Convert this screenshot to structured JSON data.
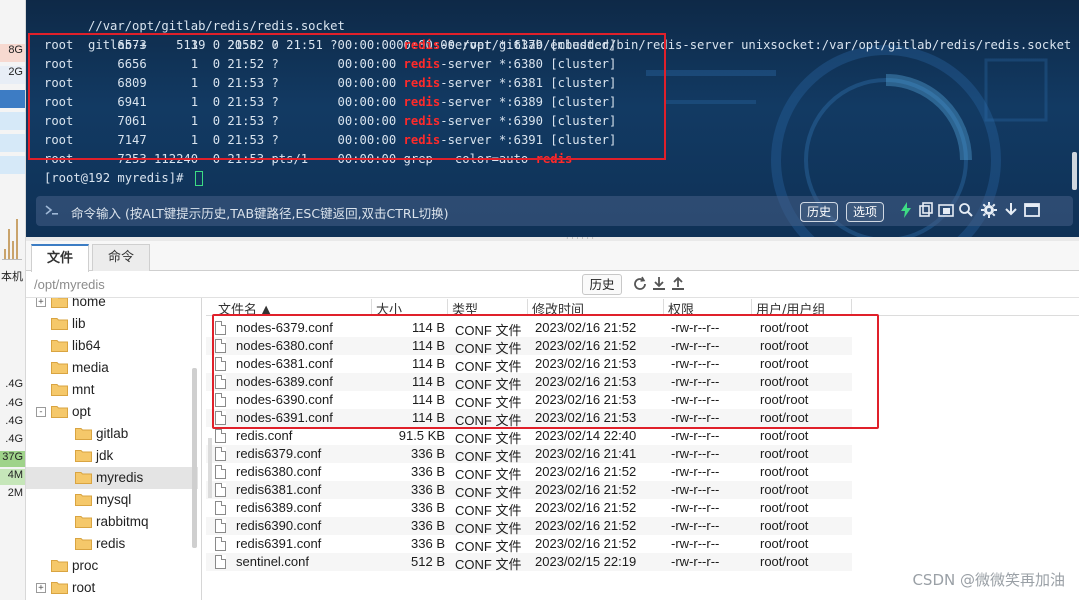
{
  "left_panel": {
    "values_top": [
      "8G",
      "2G"
    ],
    "label_mid": "本机",
    "values_bottom": [
      ".4G",
      ".4G",
      ".4G",
      ".4G",
      "37G",
      "4M",
      "2M"
    ]
  },
  "terminal": {
    "line0": "//var/opt/gitlab/redis/redis.socket",
    "line1": "gitlab-+    5139   2058  0 21:51 ?        00:00:00 /opt/gitlab/embedded/bin/redis-server unixsocket:/var/opt/gitlab/redis/redis.socket",
    "processes": [
      {
        "user": "root",
        "pid": "6573",
        "ppid": "1",
        "c": "0",
        "stime": "21:52",
        "tty": "?",
        "time": "00:00:00",
        "cmd": "redis",
        "rest": "-server *:6379 [cluster]"
      },
      {
        "user": "root",
        "pid": "6656",
        "ppid": "1",
        "c": "0",
        "stime": "21:52",
        "tty": "?",
        "time": "00:00:00",
        "cmd": "redis",
        "rest": "-server *:6380 [cluster]"
      },
      {
        "user": "root",
        "pid": "6809",
        "ppid": "1",
        "c": "0",
        "stime": "21:53",
        "tty": "?",
        "time": "00:00:00",
        "cmd": "redis",
        "rest": "-server *:6381 [cluster]"
      },
      {
        "user": "root",
        "pid": "6941",
        "ppid": "1",
        "c": "0",
        "stime": "21:53",
        "tty": "?",
        "time": "00:00:00",
        "cmd": "redis",
        "rest": "-server *:6389 [cluster]"
      },
      {
        "user": "root",
        "pid": "7061",
        "ppid": "1",
        "c": "0",
        "stime": "21:53",
        "tty": "?",
        "time": "00:00:00",
        "cmd": "redis",
        "rest": "-server *:6390 [cluster]"
      },
      {
        "user": "root",
        "pid": "7147",
        "ppid": "1",
        "c": "0",
        "stime": "21:53",
        "tty": "?",
        "time": "00:00:00",
        "cmd": "redis",
        "rest": "-server *:6391 [cluster]"
      }
    ],
    "grep_line": "root      7253 112240  0 21:53 pts/1    00:00:00 grep --color=auto ",
    "grep_keyword": "redis",
    "prompt": "[root@192 myredis]# ",
    "command_placeholder": "命令输入 (按ALT键提示历史,TAB键路径,ESC键返回,双击CTRL切换)",
    "history_button": "历史",
    "options_button": "选项",
    "icons": [
      "bolt-icon",
      "copy-icon",
      "folder-icon",
      "search-icon",
      "gear-icon",
      "download-icon",
      "window-icon"
    ]
  },
  "tabs": [
    {
      "label": "文件",
      "active": true
    },
    {
      "label": "命令",
      "active": false
    }
  ],
  "pathbar": {
    "path": "/opt/myredis",
    "history_button": "历史",
    "icons": [
      "refresh-icon",
      "download-icon",
      "upload-icon"
    ]
  },
  "tree": {
    "items": [
      {
        "label": "home",
        "depth": 1,
        "expander": "+",
        "selected": false
      },
      {
        "label": "lib",
        "depth": 1,
        "expander": "",
        "selected": false
      },
      {
        "label": "lib64",
        "depth": 1,
        "expander": "",
        "selected": false
      },
      {
        "label": "media",
        "depth": 1,
        "expander": "",
        "selected": false
      },
      {
        "label": "mnt",
        "depth": 1,
        "expander": "",
        "selected": false
      },
      {
        "label": "opt",
        "depth": 1,
        "expander": "-",
        "selected": false
      },
      {
        "label": "gitlab",
        "depth": 2,
        "expander": "",
        "selected": false
      },
      {
        "label": "jdk",
        "depth": 2,
        "expander": "",
        "selected": false
      },
      {
        "label": "myredis",
        "depth": 2,
        "expander": "",
        "selected": true
      },
      {
        "label": "mysql",
        "depth": 2,
        "expander": "",
        "selected": false
      },
      {
        "label": "rabbitmq",
        "depth": 2,
        "expander": "",
        "selected": false
      },
      {
        "label": "redis",
        "depth": 2,
        "expander": "",
        "selected": false
      },
      {
        "label": "proc",
        "depth": 1,
        "expander": "",
        "selected": false
      },
      {
        "label": "root",
        "depth": 1,
        "expander": "+",
        "selected": false
      }
    ]
  },
  "filelist": {
    "columns": [
      "文件名 ▲",
      "大小",
      "类型",
      "修改时间",
      "权限",
      "用户/用户组"
    ],
    "rows": [
      {
        "name": "nodes-6379.conf",
        "size": "114 B",
        "type": "CONF 文件",
        "mtime": "2023/02/16 21:52",
        "perm": "-rw-r--r--",
        "owner": "root/root"
      },
      {
        "name": "nodes-6380.conf",
        "size": "114 B",
        "type": "CONF 文件",
        "mtime": "2023/02/16 21:52",
        "perm": "-rw-r--r--",
        "owner": "root/root"
      },
      {
        "name": "nodes-6381.conf",
        "size": "114 B",
        "type": "CONF 文件",
        "mtime": "2023/02/16 21:53",
        "perm": "-rw-r--r--",
        "owner": "root/root"
      },
      {
        "name": "nodes-6389.conf",
        "size": "114 B",
        "type": "CONF 文件",
        "mtime": "2023/02/16 21:53",
        "perm": "-rw-r--r--",
        "owner": "root/root"
      },
      {
        "name": "nodes-6390.conf",
        "size": "114 B",
        "type": "CONF 文件",
        "mtime": "2023/02/16 21:53",
        "perm": "-rw-r--r--",
        "owner": "root/root"
      },
      {
        "name": "nodes-6391.conf",
        "size": "114 B",
        "type": "CONF 文件",
        "mtime": "2023/02/16 21:53",
        "perm": "-rw-r--r--",
        "owner": "root/root"
      },
      {
        "name": "redis.conf",
        "size": "91.5 KB",
        "type": "CONF 文件",
        "mtime": "2023/02/14 22:40",
        "perm": "-rw-r--r--",
        "owner": "root/root"
      },
      {
        "name": "redis6379.conf",
        "size": "336 B",
        "type": "CONF 文件",
        "mtime": "2023/02/16 21:41",
        "perm": "-rw-r--r--",
        "owner": "root/root"
      },
      {
        "name": "redis6380.conf",
        "size": "336 B",
        "type": "CONF 文件",
        "mtime": "2023/02/16 21:52",
        "perm": "-rw-r--r--",
        "owner": "root/root"
      },
      {
        "name": "redis6381.conf",
        "size": "336 B",
        "type": "CONF 文件",
        "mtime": "2023/02/16 21:52",
        "perm": "-rw-r--r--",
        "owner": "root/root"
      },
      {
        "name": "redis6389.conf",
        "size": "336 B",
        "type": "CONF 文件",
        "mtime": "2023/02/16 21:52",
        "perm": "-rw-r--r--",
        "owner": "root/root"
      },
      {
        "name": "redis6390.conf",
        "size": "336 B",
        "type": "CONF 文件",
        "mtime": "2023/02/16 21:52",
        "perm": "-rw-r--r--",
        "owner": "root/root"
      },
      {
        "name": "redis6391.conf",
        "size": "336 B",
        "type": "CONF 文件",
        "mtime": "2023/02/16 21:52",
        "perm": "-rw-r--r--",
        "owner": "root/root"
      },
      {
        "name": "sentinel.conf",
        "size": "512 B",
        "type": "CONF 文件",
        "mtime": "2023/02/15 22:19",
        "perm": "-rw-r--r--",
        "owner": "root/root"
      }
    ]
  },
  "watermark": "CSDN @微微笑再加油",
  "colors": {
    "terminal_bg": "#123a63",
    "keyword": "#ff2a2a",
    "annotation_box": "#e0202a",
    "accent": "#3c7dc4",
    "folder": "#f5c86a"
  }
}
